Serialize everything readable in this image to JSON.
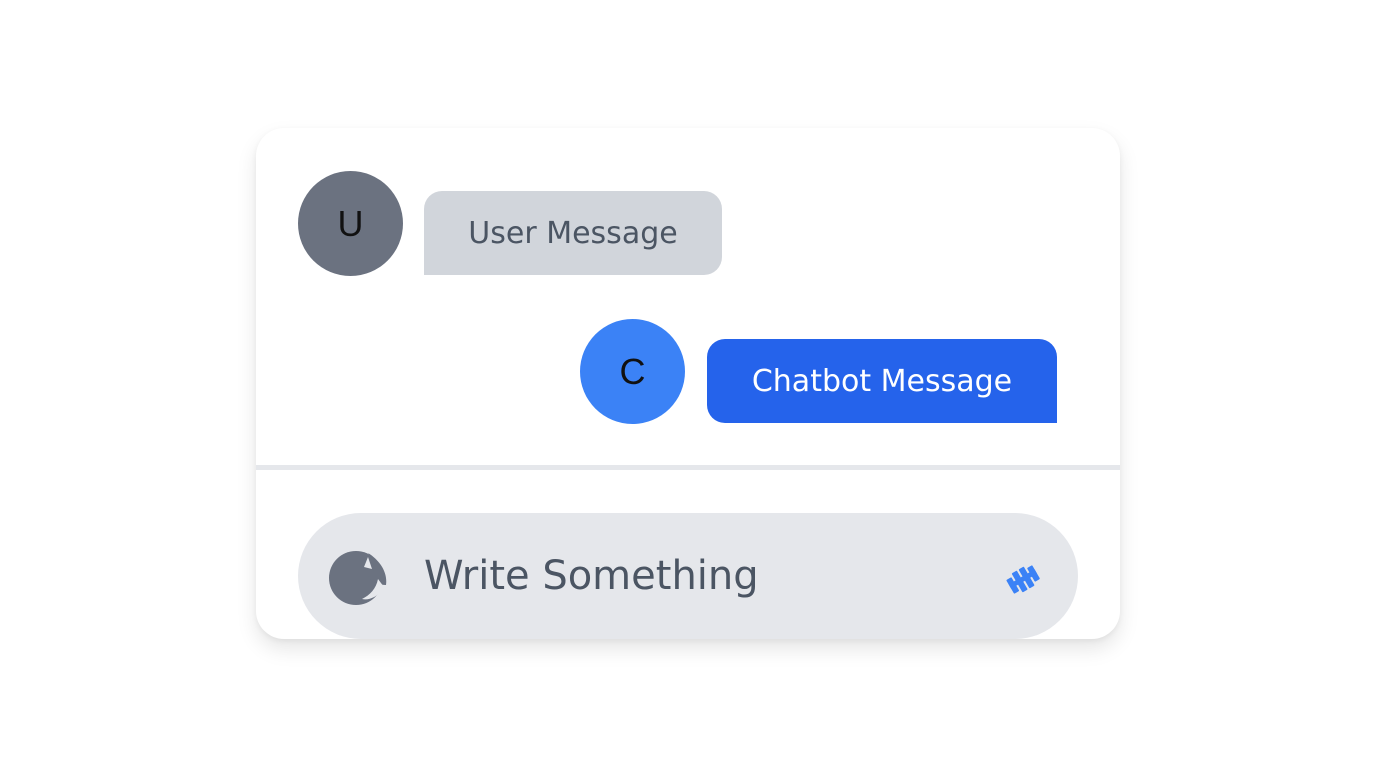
{
  "chat": {
    "messages": [
      {
        "sender": "user",
        "avatar_initial": "U",
        "text": "User Message"
      },
      {
        "sender": "chatbot",
        "avatar_initial": "C",
        "text": "Chatbot Message"
      }
    ]
  },
  "composer": {
    "placeholder": "Write Something",
    "value": "",
    "attach_icon": "emoji-icon",
    "send_icon": "send-icon"
  },
  "colors": {
    "user_avatar": "#6b7280",
    "user_bubble": "#d1d5db",
    "chatbot_avatar": "#3b82f6",
    "chatbot_bubble": "#2563eb",
    "composer_bg": "#e5e7eb",
    "send_icon": "#3b82f6"
  }
}
